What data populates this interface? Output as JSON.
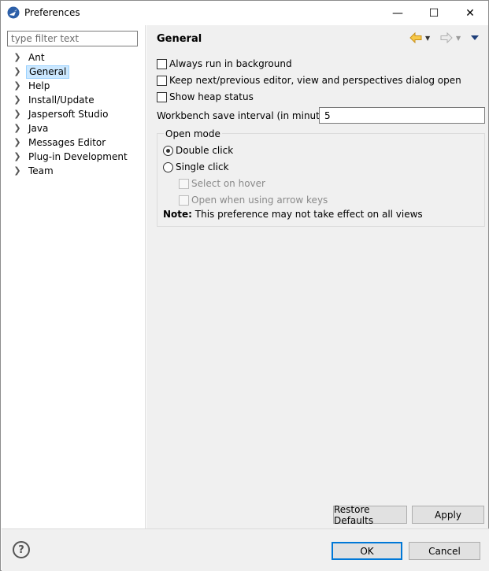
{
  "window": {
    "title": "Preferences",
    "minimize_glyph": "—",
    "maximize_glyph": "☐",
    "close_glyph": "✕"
  },
  "sidebar": {
    "filter_placeholder": "type filter text",
    "items": [
      {
        "label": "Ant",
        "selected": false
      },
      {
        "label": "General",
        "selected": true
      },
      {
        "label": "Help",
        "selected": false
      },
      {
        "label": "Install/Update",
        "selected": false
      },
      {
        "label": "Jaspersoft Studio",
        "selected": false
      },
      {
        "label": "Java",
        "selected": false
      },
      {
        "label": "Messages Editor",
        "selected": false
      },
      {
        "label": "Plug-in Development",
        "selected": false
      },
      {
        "label": "Team",
        "selected": false
      }
    ]
  },
  "page": {
    "title": "General",
    "options": {
      "always_run_background": {
        "label": "Always run in background",
        "checked": false
      },
      "keep_next_previous": {
        "label": "Keep next/previous editor, view and perspectives dialog open",
        "checked": false
      },
      "show_heap_status": {
        "label": "Show heap status",
        "checked": false
      }
    },
    "save_interval": {
      "label": "Workbench save interval (in minutes):",
      "value": "5"
    },
    "open_mode": {
      "legend": "Open mode",
      "double_click": {
        "label": "Double click",
        "checked": true
      },
      "single_click": {
        "label": "Single click",
        "checked": false
      },
      "select_on_hover": {
        "label": "Select on hover",
        "checked": false,
        "enabled": false
      },
      "open_arrow_keys": {
        "label": "Open when using arrow keys",
        "checked": false,
        "enabled": false
      },
      "note_bold": "Note:",
      "note_text": " This preference may not take effect on all views"
    },
    "buttons": {
      "restore_defaults": "Restore Defaults",
      "apply": "Apply"
    }
  },
  "footer": {
    "help_glyph": "?",
    "ok": "OK",
    "cancel": "Cancel"
  },
  "colors": {
    "selection_bg": "#cce8ff",
    "selection_border": "#99d1ff",
    "default_button_border": "#0078d7",
    "nav_arrow": "#e8a317"
  }
}
